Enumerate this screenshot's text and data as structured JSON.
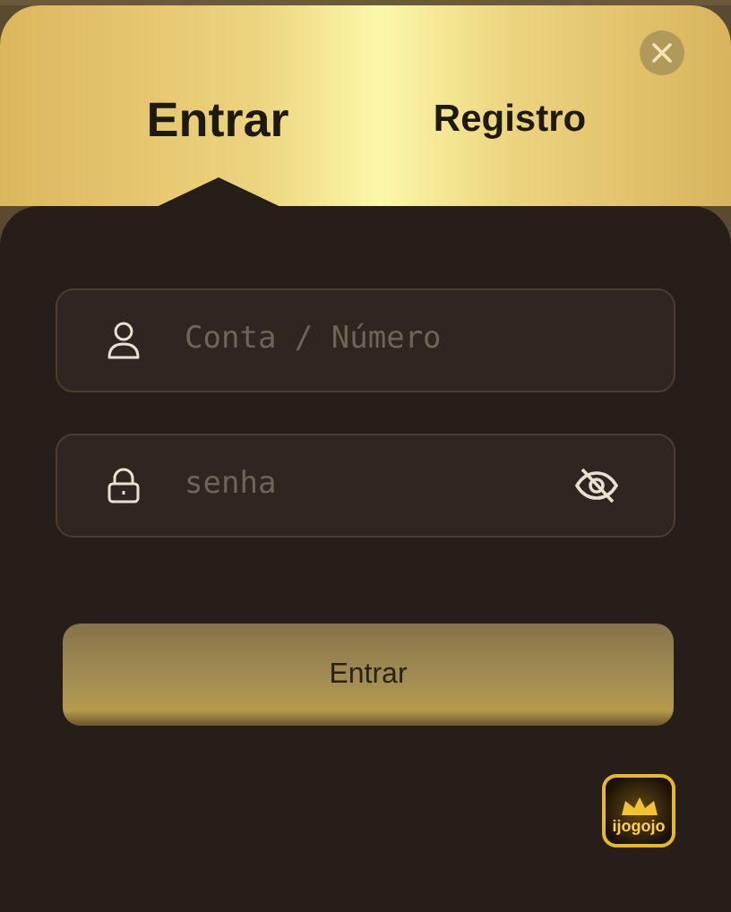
{
  "tabs": [
    {
      "label": "Entrar",
      "selected": true
    },
    {
      "label": "Registro",
      "selected": false
    }
  ],
  "fields": [
    {
      "kind": "account",
      "placeholder": "Conta / Número"
    },
    {
      "kind": "password",
      "placeholder": "senha",
      "visible": false
    }
  ],
  "submit": {
    "label": "Entrar"
  },
  "logo": {
    "text": "ijogojo"
  }
}
